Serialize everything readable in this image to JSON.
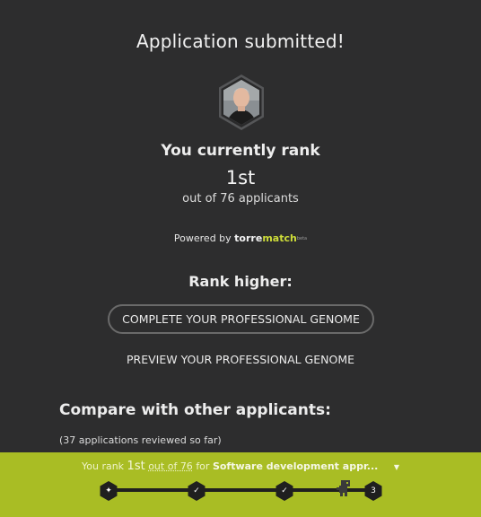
{
  "main": {
    "title": "Application submitted!",
    "rank_label": "You currently rank",
    "rank_value": "1st",
    "rank_sub": "out of 76 applicants",
    "powered_prefix": "Powered by ",
    "powered_brand_a": "torre",
    "powered_brand_b": "match",
    "powered_brand_c": "beta",
    "rank_higher": "Rank higher:",
    "complete_genome_button": "COMPLETE YOUR PROFESSIONAL GENOME",
    "preview_genome_button": "PREVIEW YOUR PROFESSIONAL GENOME",
    "compare_title": "Compare with other applicants:",
    "compare_sub": "(37 applications reviewed so far)"
  },
  "footer": {
    "you_rank": "You rank",
    "rank_num": "1st",
    "out_of": "out of 76",
    "for": "for",
    "job_title": "Software development appr...",
    "caret": "▼",
    "steps": [
      {
        "icon": "sparkle-icon",
        "label": "✦"
      },
      {
        "icon": "check-icon",
        "label": "✓"
      },
      {
        "icon": "check-icon",
        "label": "✓"
      },
      {
        "icon": "step-number",
        "label": "3"
      }
    ]
  },
  "colors": {
    "background": "#2d2d2e",
    "footer": "#a9bd24",
    "accent": "#cddc39",
    "node": "#1f1f1f"
  }
}
